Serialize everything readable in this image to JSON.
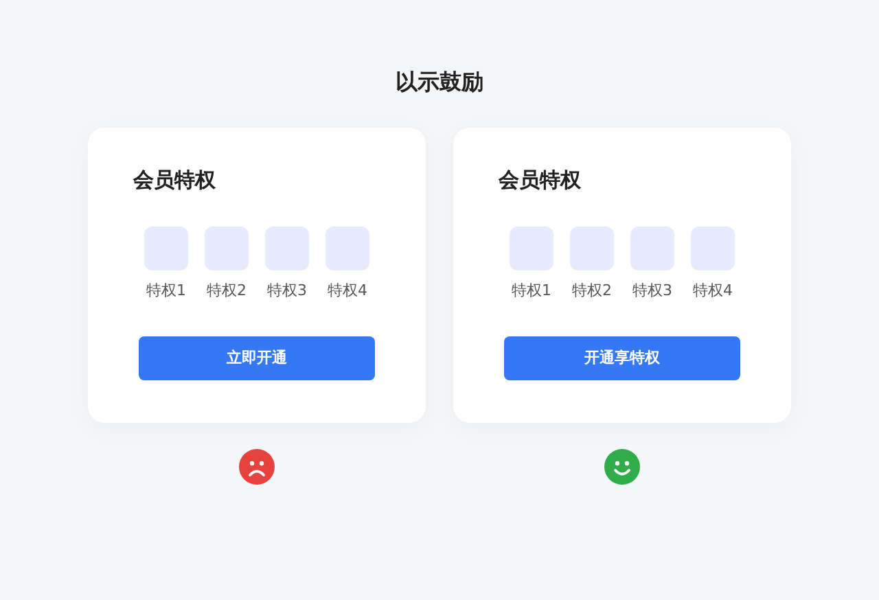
{
  "title": "以示鼓励",
  "cards": [
    {
      "heading": "会员特权",
      "perks": [
        "特权1",
        "特权2",
        "特权3",
        "特权4"
      ],
      "button": "立即开通",
      "verdict": {
        "kind": "bad"
      }
    },
    {
      "heading": "会员特权",
      "perks": [
        "特权1",
        "特权2",
        "特权3",
        "特权4"
      ],
      "button": "开通享特权",
      "verdict": {
        "kind": "good"
      }
    }
  ]
}
